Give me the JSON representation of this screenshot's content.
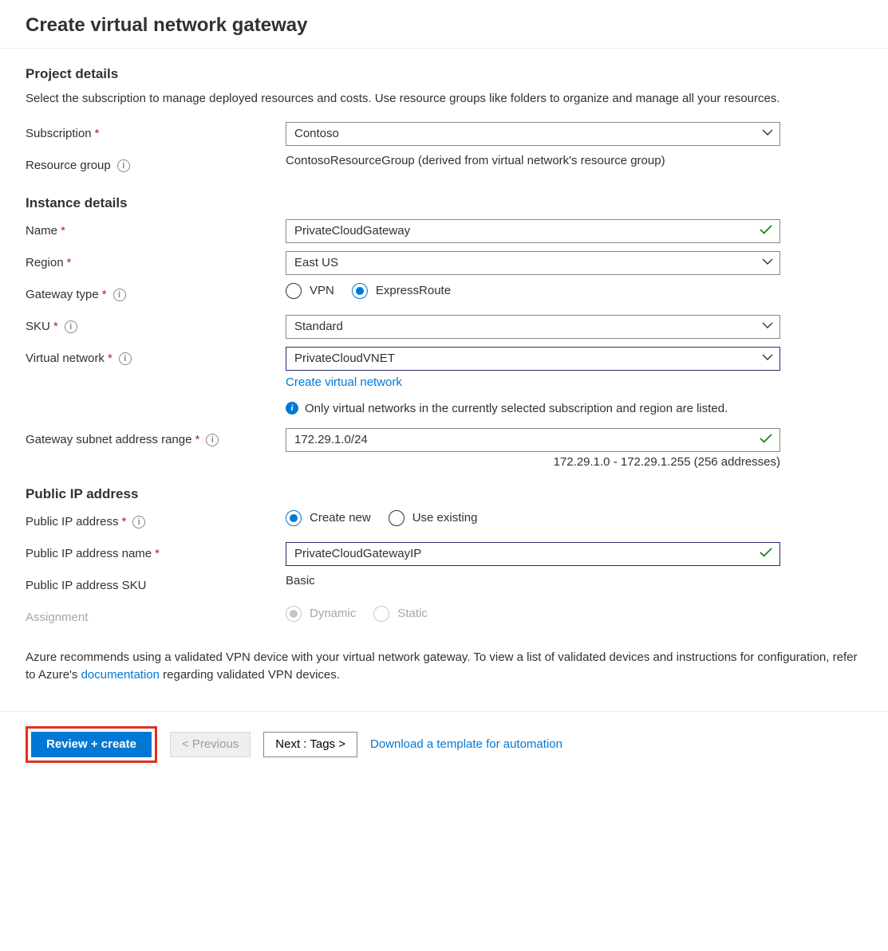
{
  "header": {
    "title": "Create virtual network gateway"
  },
  "project": {
    "section_title": "Project details",
    "description": "Select the subscription to manage deployed resources and costs. Use resource groups like folders to organize and manage all your resources.",
    "subscription_label": "Subscription",
    "subscription_value": "Contoso",
    "resource_group_label": "Resource group",
    "resource_group_value": "ContosoResourceGroup (derived from virtual network's resource group)"
  },
  "instance": {
    "section_title": "Instance details",
    "name_label": "Name",
    "name_value": "PrivateCloudGateway",
    "region_label": "Region",
    "region_value": "East US",
    "gateway_type_label": "Gateway type",
    "gateway_type_options": {
      "vpn": "VPN",
      "expressroute": "ExpressRoute"
    },
    "gateway_type_selected": "expressroute",
    "sku_label": "SKU",
    "sku_value": "Standard",
    "vnet_label": "Virtual network",
    "vnet_value": "PrivateCloudVNET",
    "vnet_create_link": "Create virtual network",
    "vnet_note": "Only virtual networks in the currently selected subscription and region are listed.",
    "subnet_label": "Gateway subnet address range",
    "subnet_value": "172.29.1.0/24",
    "subnet_helper": "172.29.1.0 - 172.29.1.255 (256 addresses)"
  },
  "pip": {
    "section_title": "Public IP address",
    "pip_label": "Public IP address",
    "pip_options": {
      "create": "Create new",
      "existing": "Use existing"
    },
    "pip_selected": "create",
    "pip_name_label": "Public IP address name",
    "pip_name_value": "PrivateCloudGatewayIP",
    "pip_sku_label": "Public IP address SKU",
    "pip_sku_value": "Basic",
    "assignment_label": "Assignment",
    "assignment_options": {
      "dynamic": "Dynamic",
      "static": "Static"
    },
    "assignment_selected": "dynamic"
  },
  "footnote": {
    "pre": "Azure recommends using a validated VPN device with your virtual network gateway. To view a list of validated devices and instructions for configuration, refer to Azure's ",
    "link": "documentation",
    "post": " regarding validated VPN devices."
  },
  "footer": {
    "review": "Review + create",
    "previous": "< Previous",
    "next": "Next : Tags >",
    "download": "Download a template for automation"
  }
}
